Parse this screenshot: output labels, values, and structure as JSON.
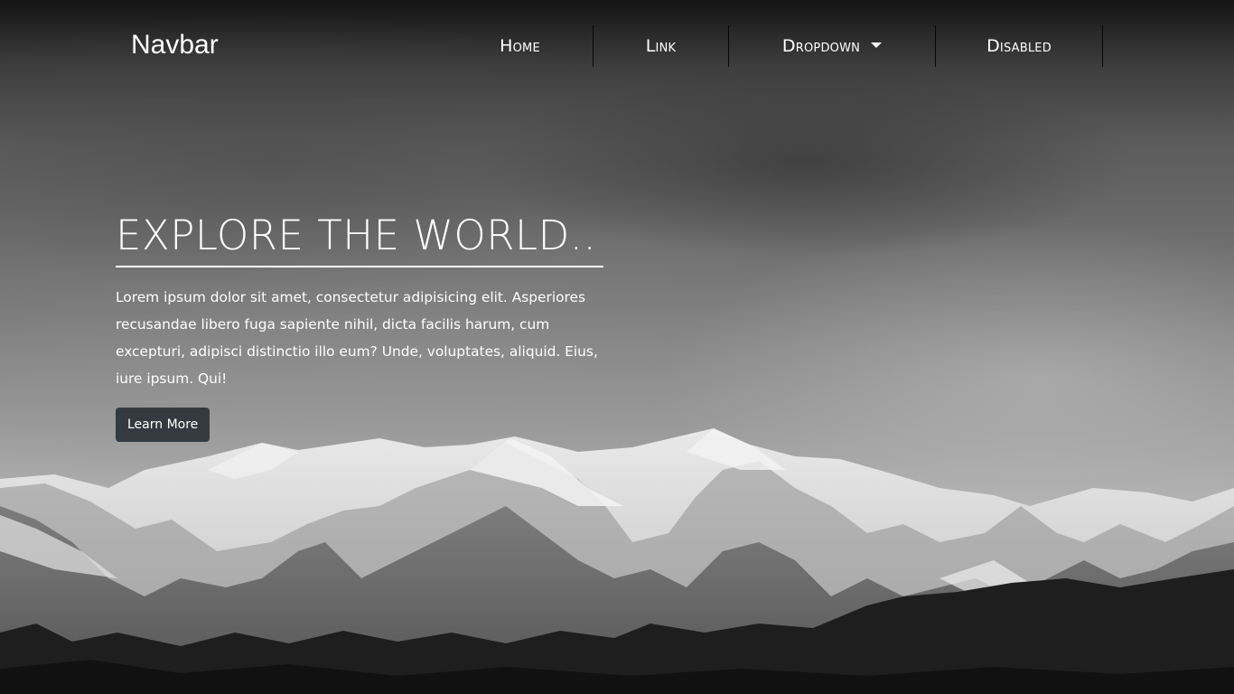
{
  "navbar": {
    "brand": "Navbar",
    "items": [
      {
        "label": "Home"
      },
      {
        "label": "Link"
      },
      {
        "label": "Dropdown"
      },
      {
        "label": "Disabled"
      }
    ]
  },
  "hero": {
    "title": "EXPLORE THE WORLD..!!!",
    "text": "Lorem ipsum dolor sit amet, consectetur adipisicing elit. Asperiores recusandae libero fuga sapiente nihil, dicta facilis harum, cum excepturi, adipisci distinctio illo eum? Unde, voluptates, aliquid. Eius, iure ipsum. Qui!",
    "button_label": "Learn More"
  },
  "colors": {
    "button_bg": "#343a40",
    "text": "#ffffff"
  }
}
